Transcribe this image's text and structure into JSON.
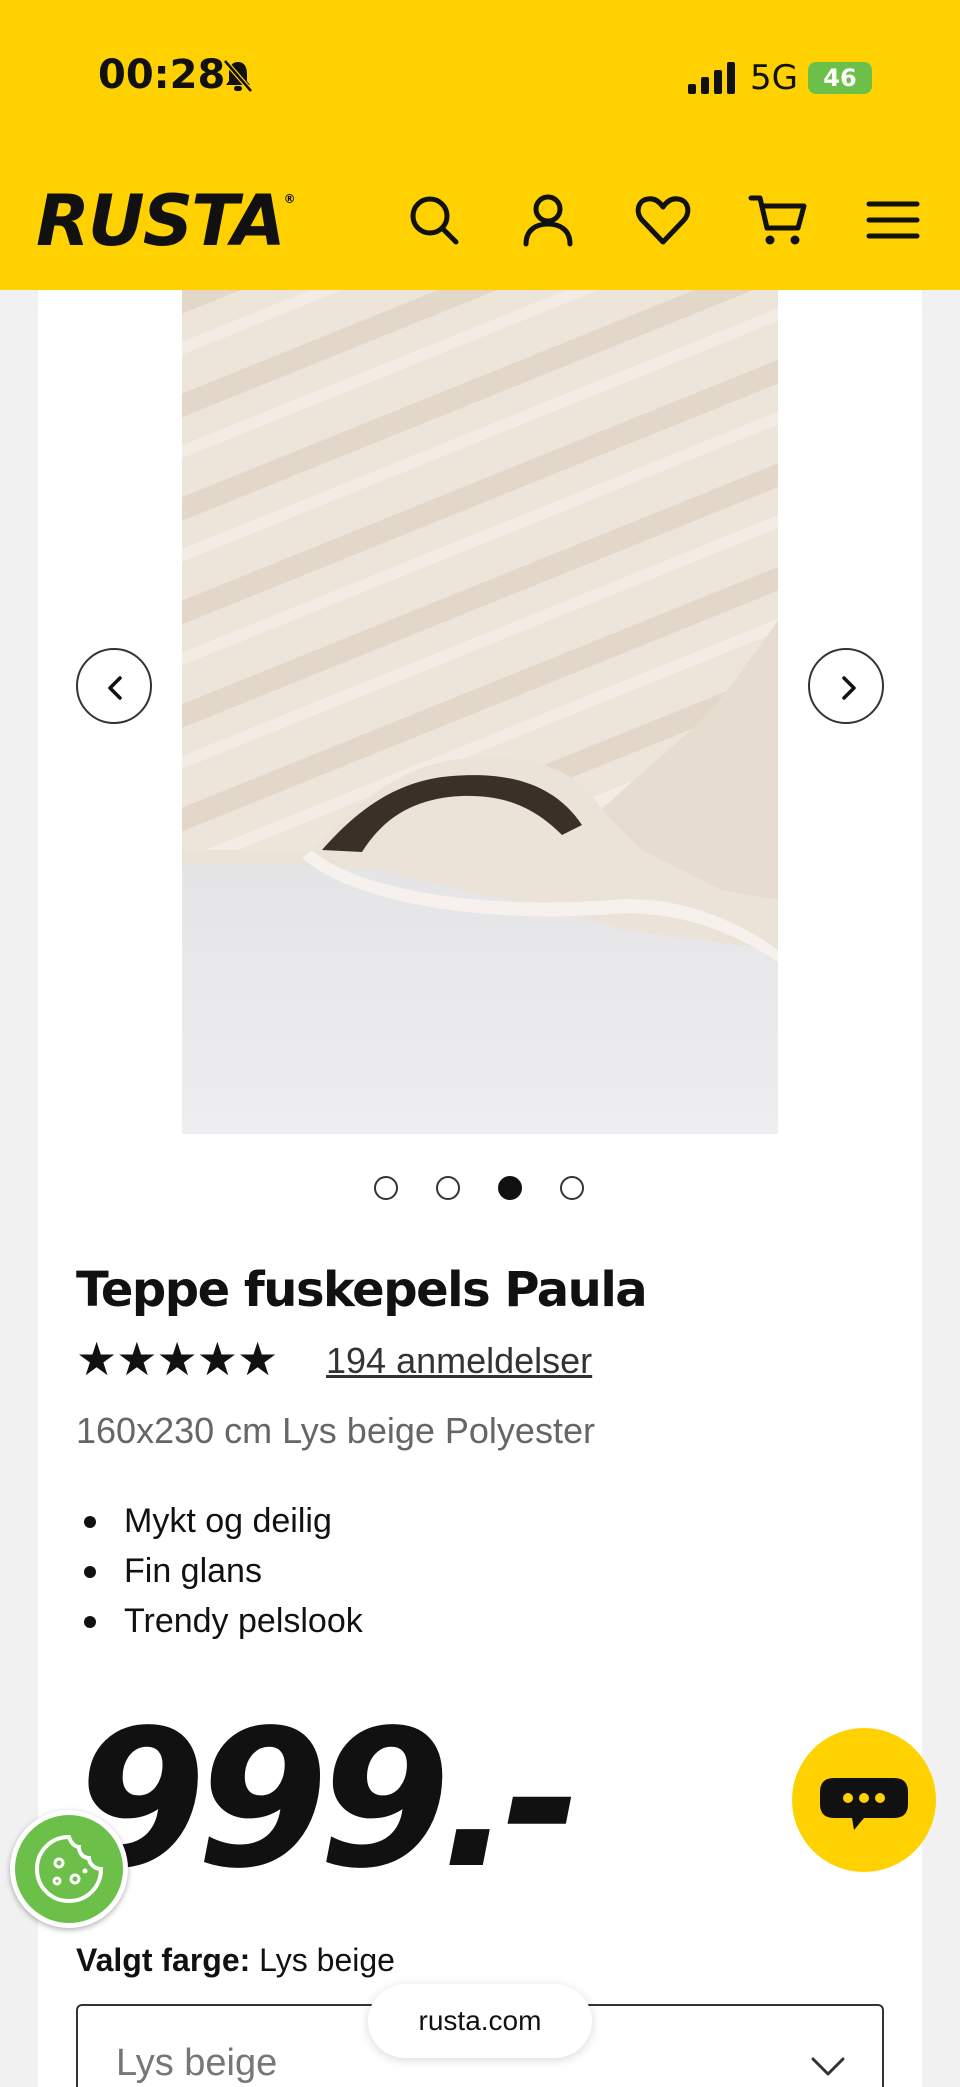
{
  "status_bar": {
    "time": "00:28",
    "network": "5G",
    "battery": "46"
  },
  "header": {
    "logo": "RUSTA",
    "icons": [
      "search-icon",
      "account-icon",
      "heart-icon",
      "cart-icon",
      "menu-icon"
    ],
    "brand_color": "#ffd100"
  },
  "carousel": {
    "image_count": 4,
    "active_index": 2
  },
  "product": {
    "title": "Teppe fuskepels Paula",
    "stars": "★★★★★",
    "rating": 5,
    "reviews": "194 anmeldelser",
    "spec": "160x230 cm Lys beige Polyester",
    "bullets": [
      "Mykt og deilig",
      "Fin glans",
      "Trendy pelslook"
    ],
    "price": "999.-"
  },
  "color": {
    "label": "Valgt farge:",
    "value": "Lys beige",
    "select_value": "Lys beige"
  },
  "browser": {
    "url": "rusta.com"
  }
}
